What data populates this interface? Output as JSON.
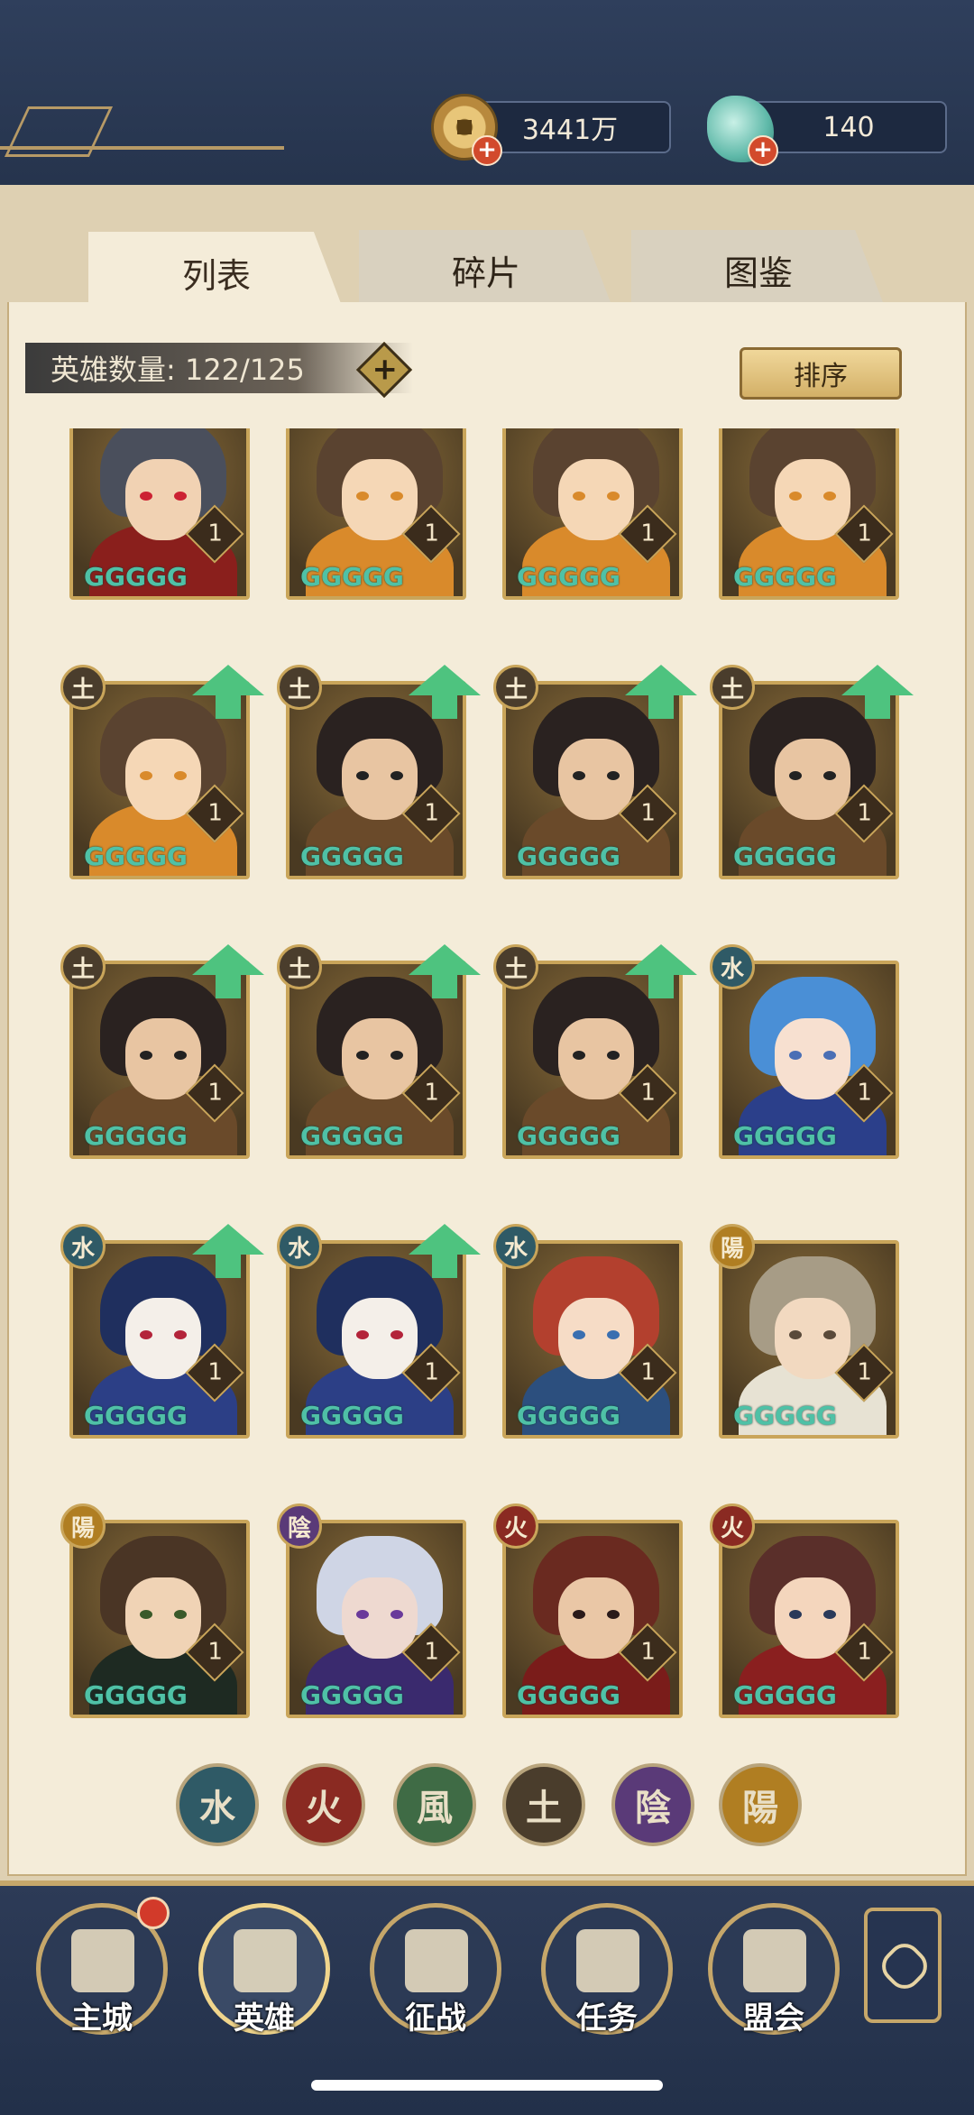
{
  "header": {
    "coins": "3441万",
    "jade": "140"
  },
  "tabs": [
    {
      "label": "列表",
      "active": true
    },
    {
      "label": "碎片",
      "active": false
    },
    {
      "label": "图鉴",
      "active": false
    }
  ],
  "hero_count": {
    "label": "英雄数量: 122/125",
    "plus": "+"
  },
  "sort_label": "排序",
  "heroes": [
    {
      "element": "",
      "level": "1",
      "stars": "GGGGG",
      "upgrade": false,
      "look": "masked"
    },
    {
      "element": "",
      "level": "1",
      "stars": "GGGGG",
      "upgrade": false,
      "look": "youth"
    },
    {
      "element": "",
      "level": "1",
      "stars": "GGGGG",
      "upgrade": false,
      "look": "youth"
    },
    {
      "element": "",
      "level": "1",
      "stars": "GGGGG",
      "upgrade": false,
      "look": "youth"
    },
    {
      "element": "土",
      "level": "1",
      "stars": "GGGGG",
      "upgrade": true,
      "look": "youth"
    },
    {
      "element": "土",
      "level": "1",
      "stars": "GGGGG",
      "upgrade": true,
      "look": "general"
    },
    {
      "element": "土",
      "level": "1",
      "stars": "GGGGG",
      "upgrade": true,
      "look": "general"
    },
    {
      "element": "土",
      "level": "1",
      "stars": "GGGGG",
      "upgrade": true,
      "look": "general"
    },
    {
      "element": "土",
      "level": "1",
      "stars": "GGGGG",
      "upgrade": true,
      "look": "general"
    },
    {
      "element": "土",
      "level": "1",
      "stars": "GGGGG",
      "upgrade": true,
      "look": "general"
    },
    {
      "element": "土",
      "level": "1",
      "stars": "GGGGG",
      "upgrade": true,
      "look": "general"
    },
    {
      "element": "水",
      "level": "1",
      "stars": "GGGGG",
      "upgrade": false,
      "look": "bluehair"
    },
    {
      "element": "水",
      "level": "1",
      "stars": "GGGGG",
      "upgrade": true,
      "look": "opera"
    },
    {
      "element": "水",
      "level": "1",
      "stars": "GGGGG",
      "upgrade": true,
      "look": "opera"
    },
    {
      "element": "水",
      "level": "1",
      "stars": "GGGGG",
      "upgrade": false,
      "look": "redhair"
    },
    {
      "element": "陽",
      "level": "1",
      "stars": "GGGGG",
      "upgrade": false,
      "look": "scholar"
    },
    {
      "element": "陽",
      "level": "1",
      "stars": "GGGGG",
      "upgrade": false,
      "look": "darkrobe"
    },
    {
      "element": "陰",
      "level": "1",
      "stars": "GGGGG",
      "upgrade": false,
      "look": "purple"
    },
    {
      "element": "火",
      "level": "1",
      "stars": "GGGGG",
      "upgrade": false,
      "look": "warrior"
    },
    {
      "element": "火",
      "level": "1",
      "stars": "GGGGG",
      "upgrade": false,
      "look": "woman"
    }
  ],
  "filters": [
    {
      "glyph": "水",
      "name": "water"
    },
    {
      "glyph": "火",
      "name": "fire"
    },
    {
      "glyph": "風",
      "name": "wind"
    },
    {
      "glyph": "土",
      "name": "earth"
    },
    {
      "glyph": "陰",
      "name": "yin"
    },
    {
      "glyph": "陽",
      "name": "yang"
    }
  ],
  "nav": [
    {
      "label": "主城",
      "name": "main-city"
    },
    {
      "label": "英雄",
      "name": "heroes"
    },
    {
      "label": "征战",
      "name": "campaign"
    },
    {
      "label": "任务",
      "name": "tasks"
    },
    {
      "label": "盟会",
      "name": "guild"
    }
  ],
  "colors": {
    "water": "#2f5a66",
    "fire": "#8a2a22",
    "wind": "#3f6b45",
    "earth": "#4a3d2c",
    "yin": "#5a3a78",
    "yang": "#b07e22"
  }
}
